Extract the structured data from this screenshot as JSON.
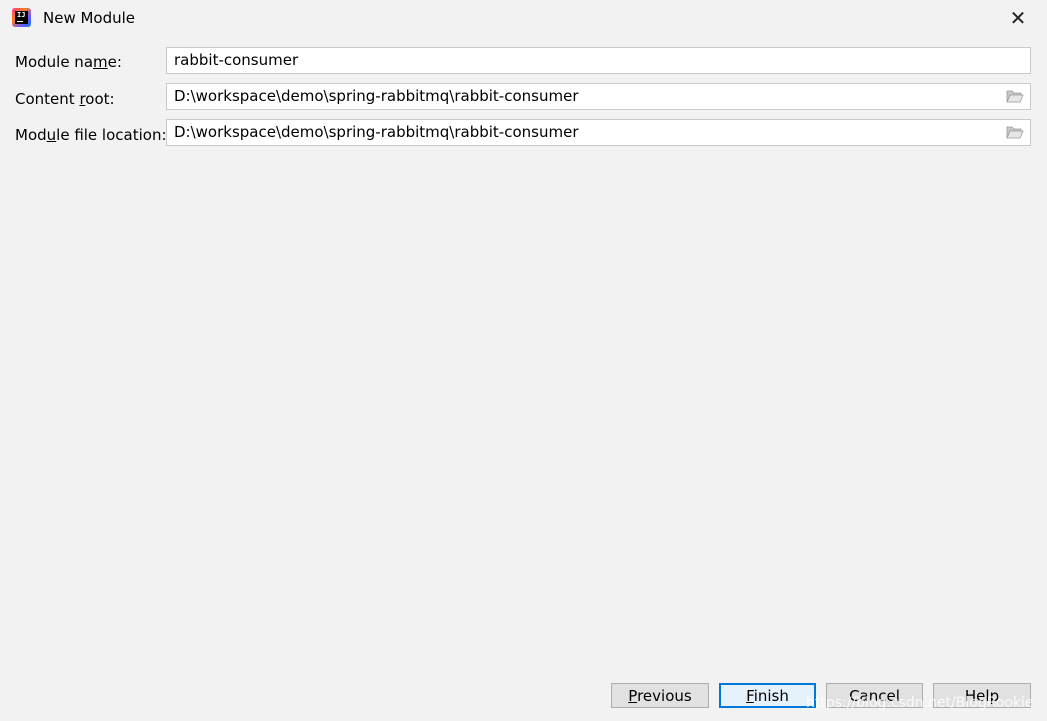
{
  "window": {
    "title": "New Module",
    "icon": "intellij-app-icon",
    "close_glyph": "✕"
  },
  "form": {
    "module_name": {
      "label_pre": "Module na",
      "label_mnemonic": "m",
      "label_post": "e:",
      "value": "rabbit-consumer"
    },
    "content_root": {
      "label_pre": "Content ",
      "label_mnemonic": "r",
      "label_post": "oot:",
      "value": "D:\\workspace\\demo\\spring-rabbitmq\\rabbit-consumer"
    },
    "module_file_location": {
      "label_pre": "Mod",
      "label_mnemonic": "u",
      "label_post": "le file location:",
      "value": "D:\\workspace\\demo\\spring-rabbitmq\\rabbit-consumer"
    }
  },
  "buttons": {
    "previous": {
      "mnemonic": "P",
      "rest": "revious"
    },
    "finish": {
      "mnemonic": "F",
      "rest": "inish"
    },
    "cancel": {
      "label": "Cancel"
    },
    "help": {
      "label": "Help"
    }
  },
  "watermark": "https://blog.csdn.net/BlogRookie",
  "colors": {
    "background": "#f2f2f2",
    "field_border": "#c9c9c9",
    "primary_button_border": "#0078d7",
    "button_bg": "#e1e1e1"
  }
}
